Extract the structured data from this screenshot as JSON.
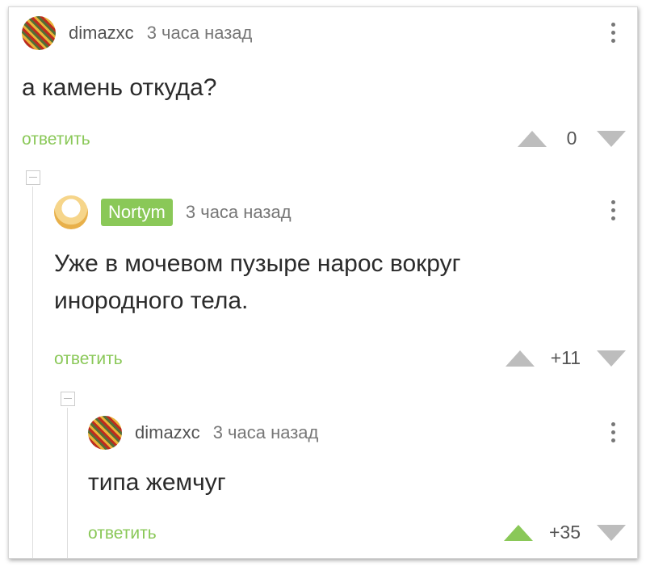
{
  "comments": [
    {
      "author": "dimazxc",
      "time": "3 часа назад",
      "text": "а камень откуда?",
      "reply_label": "ответить",
      "score": "0",
      "avatar_icon": "mosaic-avatar"
    },
    {
      "author": "Nortym",
      "time": "3 часа назад",
      "text": "Уже в мочевом пузыре нарос вокруг инородного тела.",
      "reply_label": "ответить",
      "score": "+11",
      "avatar_icon": "cake-avatar"
    },
    {
      "author": "dimazxc",
      "time": "3 часа назад",
      "text": "типа жемчуг",
      "reply_label": "ответить",
      "score": "+35",
      "avatar_icon": "mosaic-avatar",
      "upvoted": true
    }
  ],
  "colors": {
    "accent": "#8ac858",
    "vote_inactive": "#bdbdbd",
    "text": "#2b2b2b",
    "meta": "#777777"
  }
}
